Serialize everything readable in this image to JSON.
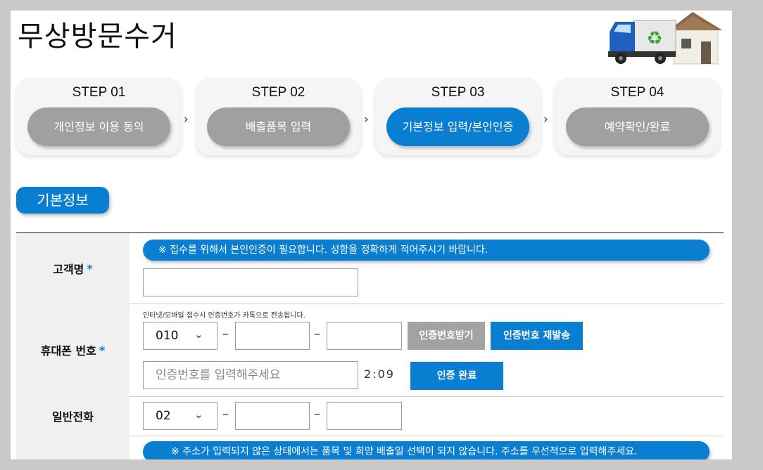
{
  "page": {
    "title": "무상방문수거"
  },
  "steps": [
    {
      "label": "STEP 01",
      "pill": "개인정보 이용 동의",
      "state": "inactive"
    },
    {
      "label": "STEP 02",
      "pill": "배출품목 입력",
      "state": "inactive"
    },
    {
      "label": "STEP 03",
      "pill": "기본정보 입력/본인인증",
      "state": "active"
    },
    {
      "label": "STEP 04",
      "pill": "예약확인/완료",
      "state": "inactive"
    }
  ],
  "step_separator": "›",
  "section": {
    "title": "기본정보"
  },
  "form": {
    "name": {
      "label": "고객명",
      "required_mark": "*",
      "notice": "※ 접수를 위해서 본인인증이 필요합니다. 성함을 정확하게 적어주시기 바랍니다.",
      "value": ""
    },
    "mobile": {
      "label": "휴대폰 번호",
      "required_mark": "*",
      "hint": "인터넷/모바일 접수시 인증번호가 카톡으로 전송됩니다.",
      "prefix": "010",
      "dash": "–",
      "part2": "",
      "part3": "",
      "request_button": "인증번호받기",
      "resend_button": "인증번호 재발송",
      "code_placeholder": "인증번호를 입력해주세요",
      "timer": "2:09",
      "confirm_button": "인증 완료"
    },
    "phone": {
      "label": "일반전화",
      "prefix": "02",
      "dash": "–",
      "part2": "",
      "part3": ""
    },
    "address": {
      "notice": "※ 주소가 입력되지 않은 상태에서는 품목 및 희망 배출일 선택이 되지 않습니다. 주소를 우선적으로 입력해주세요."
    }
  },
  "colors": {
    "accent": "#0a7ed0",
    "inactive": "#a0a0a0",
    "label_bg": "#f0f0f0"
  },
  "icons": {
    "chevron": "chevron-down-icon",
    "illustration": "recycling-truck-house-illustration"
  }
}
